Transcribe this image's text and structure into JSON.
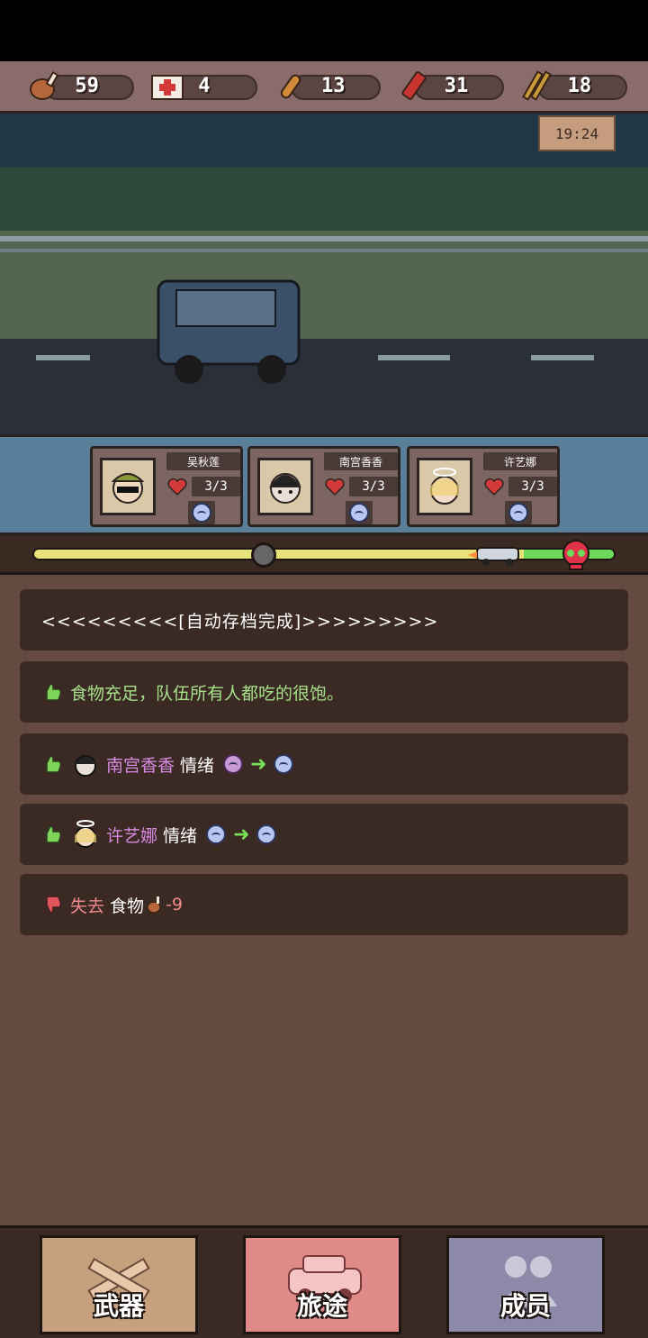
{
  "resources": [
    {
      "icon": "meat-icon",
      "value": "59"
    },
    {
      "icon": "medkit-icon",
      "value": "4"
    },
    {
      "icon": "bullet-icon",
      "value": "13"
    },
    {
      "icon": "shotgun-shell-icon",
      "value": "31"
    },
    {
      "icon": "rifle-ammo-icon",
      "value": "18"
    }
  ],
  "scene": {
    "time": "19:24"
  },
  "party": [
    {
      "name": "吴秋莲",
      "hp": "3/3",
      "mood": "sad-face-icon"
    },
    {
      "name": "南宫香香",
      "hp": "3/3",
      "mood": "sad-face-icon"
    },
    {
      "name": "许艺娜",
      "hp": "3/3",
      "mood": "sad-face-icon"
    }
  ],
  "progress": {
    "position": 0.4,
    "colors": {
      "track": "#e8e27a",
      "danger": "#6cd95a"
    }
  },
  "log": {
    "autosave": "<<<<<<<<<[自动存档完成]>>>>>>>>>",
    "food_ok": "食物充足，队伍所有人都吃的很饱。",
    "mood1_name": "南宫香香",
    "mood1_label": "情绪",
    "mood2_name": "许艺娜",
    "mood2_label": "情绪",
    "loss_label": "失去",
    "loss_item": "食物",
    "loss_value": "-9"
  },
  "nav": {
    "weapons": "武器",
    "journey": "旅途",
    "members": "成员"
  }
}
